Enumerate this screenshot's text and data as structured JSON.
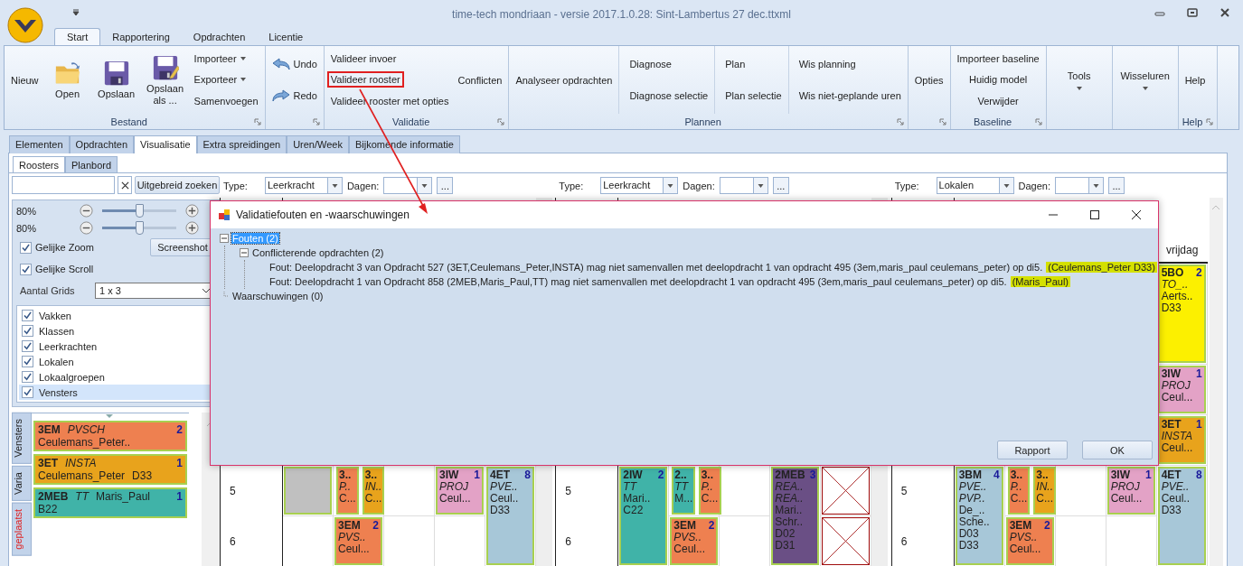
{
  "window": {
    "title": "time-tech mondriaan - versie 2017.1.0.28: Sint-Lambertus 27 dec.ttxml"
  },
  "ribbon_tabs": [
    {
      "label": "Start",
      "selected": true
    },
    {
      "label": "Rapportering",
      "selected": false
    },
    {
      "label": "Opdrachten",
      "selected": false
    },
    {
      "label": "Licentie",
      "selected": false
    }
  ],
  "ribbon_groups": [
    {
      "title": "Bestand",
      "launcher": true,
      "columns": [
        [
          {
            "label": "Nieuw",
            "kind": "text"
          }
        ],
        [
          {
            "label": "Open",
            "kind": "folder"
          }
        ],
        [
          {
            "label": "Opslaan",
            "kind": "disk"
          }
        ],
        [
          {
            "label": "Opslaan als ...",
            "kind": "diskpen"
          }
        ],
        [
          {
            "label": "Importeer",
            "kind": "menu"
          },
          {
            "label": "Exporteer",
            "kind": "menu"
          },
          {
            "label": "Samenvoegen",
            "kind": "text"
          }
        ]
      ]
    },
    {
      "launcher": true,
      "columns": [
        [
          {
            "label": "Undo",
            "kind": "undo"
          },
          {
            "label": "Redo",
            "kind": "redo"
          }
        ]
      ]
    },
    {
      "title": "Validatie",
      "launcher": true,
      "columns": [
        [
          {
            "label": "Valideer invoer",
            "kind": "text",
            "highlighted": false
          },
          {
            "label": "Valideer rooster",
            "kind": "text",
            "highlighted": true
          },
          {
            "label": "Valideer rooster met opties",
            "kind": "text",
            "highlighted": false
          }
        ],
        [
          {
            "label": "Conflicten",
            "kind": "text"
          }
        ]
      ]
    },
    {
      "title": "Plannen",
      "launcher": true,
      "columns": [
        [
          {
            "label": "Analyseer opdrachten",
            "kind": "text"
          }
        ],
        [
          {
            "label": "Diagnose",
            "kind": "text"
          },
          {
            "label": "Diagnose selectie",
            "kind": "text"
          }
        ],
        [
          {
            "label": "Plan",
            "kind": "text"
          },
          {
            "label": "Plan selectie",
            "kind": "text"
          }
        ],
        [
          {
            "label": "Wis planning",
            "kind": "text"
          },
          {
            "label": "Wis niet-geplande uren",
            "kind": "text"
          }
        ]
      ]
    },
    {
      "launcher": true,
      "columns": [
        [
          {
            "label": "Opties",
            "kind": "text"
          }
        ]
      ]
    },
    {
      "title": "Baseline",
      "launcher": true,
      "columns": [
        [
          {
            "label": "Importeer baseline",
            "kind": "text"
          },
          {
            "label": "Huidig model",
            "kind": "text"
          },
          {
            "label": "Verwijder",
            "kind": "text"
          }
        ]
      ]
    },
    {
      "launcher": false,
      "columns": [
        [
          {
            "label": "Tools",
            "kind": "dropdown"
          }
        ]
      ]
    },
    {
      "launcher": false,
      "columns": [
        [
          {
            "label": "Wisseluren",
            "kind": "dropdown"
          }
        ]
      ]
    },
    {
      "title": "Help",
      "launcher": true,
      "columns": [
        [
          {
            "label": "Help",
            "kind": "text"
          }
        ]
      ]
    }
  ],
  "doc_tabs": [
    {
      "label": "Elementen",
      "selected": false
    },
    {
      "label": "Opdrachten",
      "selected": false
    },
    {
      "label": "Visualisatie",
      "selected": true
    },
    {
      "label": "Extra spreidingen",
      "selected": false
    },
    {
      "label": "Uren/Week",
      "selected": false
    },
    {
      "label": "Bijkomende informatie",
      "selected": false
    }
  ],
  "sub_tabs": [
    {
      "label": "Roosters",
      "selected": true
    },
    {
      "label": "Planbord",
      "selected": false
    }
  ],
  "left_panel": {
    "search_button": "Uitgebreid zoeken",
    "zooms": [
      {
        "label": "80%",
        "level": 0.45
      },
      {
        "label": "80%",
        "level": 0.45
      }
    ],
    "options": [
      {
        "label": "Gelijke Zoom",
        "checked": true
      },
      {
        "label": "Gelijke Scroll",
        "checked": true
      }
    ],
    "screenshot_button": "Screenshot",
    "grids_label": "Aantal Grids",
    "grids_value": "1 x 3",
    "layers": [
      {
        "label": "Vakken",
        "checked": true,
        "selected": false
      },
      {
        "label": "Klassen",
        "checked": true,
        "selected": false
      },
      {
        "label": "Leerkrachten",
        "checked": true,
        "selected": false
      },
      {
        "label": "Lokalen",
        "checked": true,
        "selected": false
      },
      {
        "label": "Lokaalgroepen",
        "checked": true,
        "selected": false
      },
      {
        "label": "Vensters",
        "checked": true,
        "selected": true
      }
    ],
    "side_tabs": [
      {
        "label": "Vensters",
        "alert": false
      },
      {
        "label": "Varia",
        "alert": false
      },
      {
        "label": "geplaatst",
        "alert": true
      }
    ],
    "cards": [
      {
        "label": "3EM",
        "subject": "PVSCH",
        "count": "2",
        "color": "#ee8050",
        "lines": [
          "Ceulemans_Peter.."
        ]
      },
      {
        "label": "3ET",
        "subject": "INSTA",
        "count": "1",
        "color": "#e8a31c",
        "lines": [
          "Ceulemans_Peter",
          "D33"
        ]
      },
      {
        "label": "2MEB",
        "subject": "TT",
        "extra": "Maris_Paul",
        "count": "1",
        "color": "#40b3a8",
        "lines": [
          "B22"
        ]
      }
    ]
  },
  "grids": [
    {
      "type_label": "Type:",
      "type_value": "Leerkracht",
      "days_label": "Dagen:",
      "more": "...",
      "periods": [
        "5",
        "6"
      ],
      "columns": [
        {
          "slots": [
            {
              "kind": "blank",
              "double": false
            },
            {
              "kind": "empty",
              "double": false
            }
          ]
        },
        {
          "slots": [
            {
              "kind": "split",
              "double": false,
              "parts": [
                {
                  "label": "3..",
                  "subjects": [
                    "P.."
                  ],
                  "lines": [
                    "C..."
                  ],
                  "color": "#ee8050"
                },
                {
                  "label": "3..",
                  "subjects": [
                    "IN.."
                  ],
                  "lines": [
                    "C..."
                  ],
                  "color": "#e8a31c"
                }
              ]
            },
            {
              "kind": "lesson",
              "double": false,
              "label": "3EM",
              "count": "2",
              "subjects": [
                "PVS.."
              ],
              "lines": [
                "Ceul..."
              ],
              "color": "#ee8050"
            }
          ]
        },
        {
          "slots": [
            {
              "kind": "empty",
              "double": false
            },
            {
              "kind": "empty",
              "double": false
            }
          ]
        },
        {
          "slots": [
            {
              "kind": "lesson",
              "double": false,
              "label": "3IW",
              "count": "1",
              "subjects": [
                "PROJ"
              ],
              "lines": [
                "Ceul..."
              ],
              "color": "#e3a2c6"
            },
            {
              "kind": "empty",
              "double": false
            }
          ]
        },
        {
          "slots": [
            {
              "kind": "lesson",
              "double": true,
              "label": "4ET",
              "count": "8",
              "subjects": [
                "PVE.."
              ],
              "lines": [
                "Ceul..",
                "D33"
              ],
              "color": "#a7c7d8"
            }
          ]
        }
      ]
    },
    {
      "type_label": "Type:",
      "type_value": "Leerkracht",
      "days_label": "Dagen:",
      "more": "...",
      "periods": [
        "5",
        "6"
      ],
      "columns": [
        {
          "slots": [
            {
              "kind": "lesson",
              "double": true,
              "label": "2IW",
              "count": "2",
              "subjects": [
                "TT"
              ],
              "lines": [
                "Mari..",
                "C22"
              ],
              "color": "#40b3a8"
            }
          ]
        },
        {
          "slots": [
            {
              "kind": "split",
              "double": false,
              "parts": [
                {
                  "label": "2..",
                  "subjects": [
                    "TT"
                  ],
                  "lines": [
                    "M..."
                  ],
                  "color": "#40b3a8"
                },
                {
                  "label": "3..",
                  "subjects": [
                    "P.."
                  ],
                  "lines": [
                    "C..."
                  ],
                  "color": "#ee8050"
                }
              ]
            },
            {
              "kind": "lesson",
              "double": false,
              "label": "3EM",
              "count": "2",
              "subjects": [
                "PVS.."
              ],
              "lines": [
                "Ceul..."
              ],
              "color": "#ee8050"
            }
          ]
        },
        {
          "slots": [
            {
              "kind": "empty",
              "double": false
            },
            {
              "kind": "empty",
              "double": false
            }
          ]
        },
        {
          "slots": [
            {
              "kind": "lesson",
              "double": true,
              "label": "2MEB",
              "count": "3",
              "subjects": [
                "REA..",
                "REA.."
              ],
              "lines": [
                "Mari..",
                "Schr..",
                "D02",
                "D31"
              ],
              "color": "#6a4f85"
            }
          ]
        },
        {
          "slots": [
            {
              "kind": "crossed",
              "double": false
            },
            {
              "kind": "crossed",
              "double": false
            }
          ]
        }
      ]
    },
    {
      "type_label": "Type:",
      "type_value": "Lokalen",
      "days_label": "Dagen:",
      "more": "...",
      "periods": [
        "5",
        "6"
      ],
      "columns": [
        {
          "slots": [
            {
              "kind": "lesson",
              "double": true,
              "label": "3BM",
              "count": "4",
              "subjects": [
                "PVE..",
                "PVP.."
              ],
              "lines": [
                "De_..",
                "Sche..",
                "D03",
                "D33"
              ],
              "color": "#a7c7d8"
            }
          ]
        },
        {
          "slots": [
            {
              "kind": "split",
              "double": false,
              "parts": [
                {
                  "label": "3..",
                  "subjects": [
                    "P.."
                  ],
                  "lines": [
                    "C..."
                  ],
                  "color": "#ee8050"
                },
                {
                  "label": "3..",
                  "subjects": [
                    "IN.."
                  ],
                  "lines": [
                    "C..."
                  ],
                  "color": "#e8a31c"
                }
              ]
            },
            {
              "kind": "lesson",
              "double": false,
              "label": "3EM",
              "count": "2",
              "subjects": [
                "PVS.."
              ],
              "lines": [
                "Ceul..."
              ],
              "color": "#ee8050"
            }
          ]
        },
        {
          "slots": [
            {
              "kind": "empty",
              "double": false
            },
            {
              "kind": "empty",
              "double": false
            }
          ]
        },
        {
          "slots": [
            {
              "kind": "lesson",
              "double": false,
              "label": "3IW",
              "count": "1",
              "subjects": [
                "PROJ"
              ],
              "lines": [
                "Ceul..."
              ],
              "color": "#e3a2c6"
            },
            {
              "kind": "empty",
              "double": false
            }
          ]
        },
        {
          "header": "vrijdag",
          "slots": [
            {
              "kind": "lesson",
              "double": true,
              "label": "5BO",
              "count": "2",
              "subjects": [
                "TO_.."
              ],
              "lines": [
                "Aerts..",
                "D33"
              ],
              "color": "#fcf000"
            },
            {
              "kind": "lesson",
              "double": false,
              "label": "3IW",
              "count": "1",
              "subjects": [
                "PROJ"
              ],
              "lines": [
                "Ceul..."
              ],
              "color": "#e3a2c6"
            },
            {
              "kind": "lesson",
              "double": false,
              "label": "3ET",
              "count": "1",
              "subjects": [
                "INSTA"
              ],
              "lines": [
                "Ceul..."
              ],
              "color": "#e8a31c"
            },
            {
              "kind": "lesson",
              "double": true,
              "label": "4ET",
              "count": "8",
              "subjects": [
                "PVE.."
              ],
              "lines": [
                "Ceul..",
                "D33"
              ],
              "color": "#a7c7d8"
            }
          ]
        }
      ]
    }
  ],
  "dialog": {
    "title": "Validatiefouten en -waarschuwingen",
    "tree": [
      {
        "label": "Fouten (2)",
        "selected": true,
        "expanded": true,
        "children": [
          {
            "label": "Conflicterende opdrachten (2)",
            "selected": false,
            "expanded": true,
            "children": [
              {
                "label": "Fout: Deelopdracht 3 van Opdracht 527 (3ET,Ceulemans_Peter,INSTA) mag niet samenvallen met deelopdracht 1 van opdracht 495 (3em,maris_paul ceulemans_peter) op di5.",
                "highlight": "(Ceulemans_Peter D33)",
                "selected": false
              },
              {
                "label": "Fout: Deelopdracht 1 van Opdracht 858 (2MEB,Maris_Paul,TT) mag niet samenvallen met deelopdracht 1 van opdracht 495 (3em,maris_paul ceulemans_peter) op di5.",
                "highlight": "(Maris_Paul)",
                "selected": false
              }
            ]
          }
        ]
      },
      {
        "label": "Waarschuwingen (0)",
        "selected": false,
        "expanded": false
      }
    ],
    "buttons": [
      "Rapport",
      "OK"
    ]
  }
}
